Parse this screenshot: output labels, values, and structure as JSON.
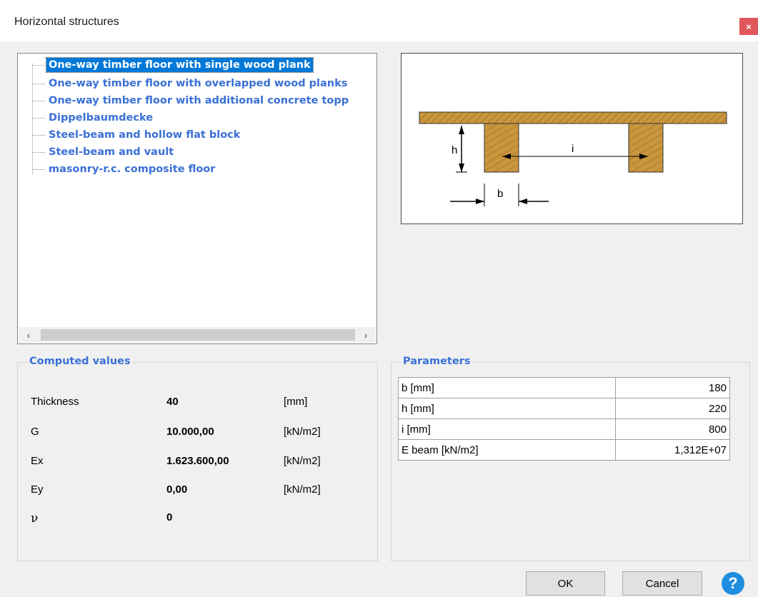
{
  "window": {
    "title": "Horizontal structures",
    "close_glyph": "×"
  },
  "tree": {
    "items": [
      {
        "label": "One-way timber floor with single wood plank",
        "selected": true
      },
      {
        "label": "One-way timber floor with overlapped wood planks",
        "selected": false
      },
      {
        "label": "One-way timber floor with additional concrete topp",
        "selected": false
      },
      {
        "label": "Dippelbaumdecke",
        "selected": false
      },
      {
        "label": "Steel-beam and hollow flat block",
        "selected": false
      },
      {
        "label": "Steel-beam and vault",
        "selected": false
      },
      {
        "label": "masonry-r.c. composite floor",
        "selected": false
      }
    ],
    "scroll_left": "‹",
    "scroll_right": "›"
  },
  "diagram": {
    "label_h": "h",
    "label_i": "i",
    "label_b": "b",
    "wood_color": "#c8963c"
  },
  "computed": {
    "title": "Computed values",
    "rows": [
      {
        "name": "Thickness",
        "value": "40",
        "unit": "[mm]"
      },
      {
        "name": "G",
        "value": "10.000,00",
        "unit": "[kN/m2]"
      },
      {
        "name": "Ex",
        "value": "1.623.600,00",
        "unit": "[kN/m2]"
      },
      {
        "name": "Ey",
        "value": "0,00",
        "unit": "[kN/m2]"
      },
      {
        "name": "ν",
        "value": "0",
        "unit": ""
      }
    ]
  },
  "parameters": {
    "title": "Parameters",
    "rows": [
      {
        "name": "b [mm]",
        "value": "180"
      },
      {
        "name": "h [mm]",
        "value": "220"
      },
      {
        "name": "i [mm]",
        "value": "800"
      },
      {
        "name": "E beam [kN/m2]",
        "value": "1,312E+07"
      }
    ]
  },
  "buttons": {
    "ok": "OK",
    "cancel": "Cancel",
    "help": "?"
  },
  "colors": {
    "accent": "#3a70d6",
    "selection": "#0078d7",
    "close": "#e0575b",
    "help": "#1f8ee0"
  }
}
